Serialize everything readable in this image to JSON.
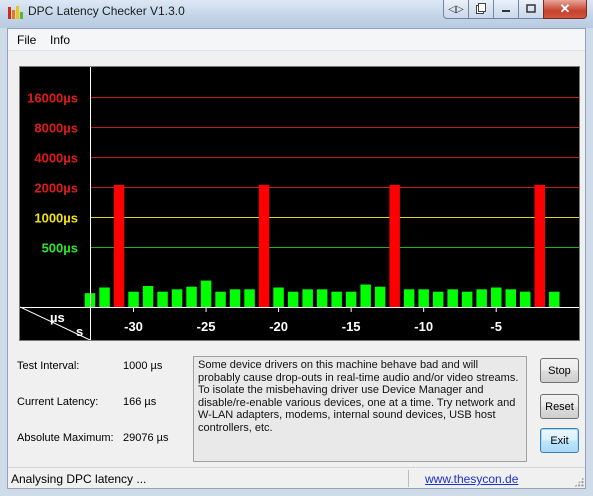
{
  "window": {
    "title": "DPC Latency Checker V1.3.0",
    "caption_buttons": [
      "restore-icon",
      "pages-icon",
      "minimize-icon",
      "maximize-icon",
      "close-icon"
    ]
  },
  "menu": [
    "File",
    "Info"
  ],
  "chart_data": {
    "type": "bar",
    "y_ticks": [
      {
        "label": "16000µs",
        "value": 16000,
        "color": "#e01b1b"
      },
      {
        "label": "8000µs",
        "value": 8000,
        "color": "#e01b1b"
      },
      {
        "label": "4000µs",
        "value": 4000,
        "color": "#e01b1b"
      },
      {
        "label": "2000µs",
        "value": 2000,
        "color": "#e01b1b"
      },
      {
        "label": "1000µs",
        "value": 1000,
        "color": "#f0e21a"
      },
      {
        "label": "500µs",
        "value": 500,
        "color": "#2ee52e"
      }
    ],
    "corner_labels": {
      "y_unit": "µs",
      "x_unit": "s"
    },
    "x_ticks": [
      "-30",
      "-25",
      "-20",
      "-15",
      "-10",
      "-5"
    ],
    "x_tick_values": [
      -30,
      -25,
      -20,
      -15,
      -10,
      -5
    ],
    "x_range": [
      -33,
      0.5
    ],
    "y_scale": "log2",
    "y_range": [
      125,
      32000
    ],
    "bar_color_ok": "#00ff00",
    "bar_color_bad": "#ff0000",
    "bars": [
      {
        "x": -33,
        "value": 172
      },
      {
        "x": -32,
        "value": 196
      },
      {
        "x": -31,
        "value": 2100
      },
      {
        "x": -30,
        "value": 178
      },
      {
        "x": -29,
        "value": 203
      },
      {
        "x": -28,
        "value": 178
      },
      {
        "x": -27,
        "value": 188
      },
      {
        "x": -26,
        "value": 200
      },
      {
        "x": -25,
        "value": 230
      },
      {
        "x": -24,
        "value": 178
      },
      {
        "x": -23,
        "value": 188
      },
      {
        "x": -22,
        "value": 188
      },
      {
        "x": -21,
        "value": 2100
      },
      {
        "x": -20,
        "value": 196
      },
      {
        "x": -19,
        "value": 178
      },
      {
        "x": -18,
        "value": 188
      },
      {
        "x": -17,
        "value": 188
      },
      {
        "x": -16,
        "value": 178
      },
      {
        "x": -15,
        "value": 178
      },
      {
        "x": -14,
        "value": 210
      },
      {
        "x": -13,
        "value": 200
      },
      {
        "x": -12,
        "value": 2100
      },
      {
        "x": -11,
        "value": 188
      },
      {
        "x": -10,
        "value": 188
      },
      {
        "x": -9,
        "value": 178
      },
      {
        "x": -8,
        "value": 188
      },
      {
        "x": -7,
        "value": 178
      },
      {
        "x": -6,
        "value": 188
      },
      {
        "x": -5,
        "value": 196
      },
      {
        "x": -4,
        "value": 188
      },
      {
        "x": -3,
        "value": 178
      },
      {
        "x": -2,
        "value": 2100
      },
      {
        "x": -1,
        "value": 178
      }
    ]
  },
  "info": {
    "test_interval_label": "Test Interval:",
    "test_interval_value": "1000 µs",
    "current_latency_label": "Current Latency:",
    "current_latency_value": "166 µs",
    "absolute_maximum_label": "Absolute Maximum:",
    "absolute_maximum_value": "29076 µs"
  },
  "message": "Some device drivers on this machine behave bad and will probably cause drop-outs in real-time audio and/or video streams. To isolate the misbehaving driver use Device Manager and disable/re-enable various devices, one at a time. Try network and W-LAN adapters, modems, internal sound devices, USB host controllers, etc.",
  "buttons": {
    "stop": "Stop",
    "reset": "Reset",
    "exit": "Exit"
  },
  "status": {
    "text": "Analysing DPC latency ...",
    "link": "www.thesycon.de"
  }
}
